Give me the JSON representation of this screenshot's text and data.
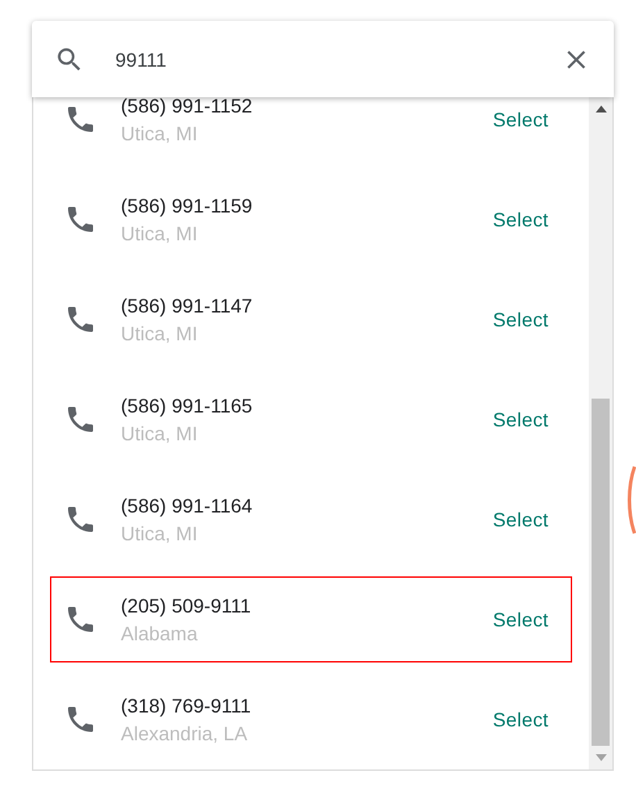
{
  "search": {
    "value": "99111"
  },
  "results": [
    {
      "number": "(586) 991-1152",
      "location": "Utica, MI",
      "action": "Select",
      "selected": false
    },
    {
      "number": "(586) 991-1159",
      "location": "Utica, MI",
      "action": "Select",
      "selected": false
    },
    {
      "number": "(586) 991-1147",
      "location": "Utica, MI",
      "action": "Select",
      "selected": false
    },
    {
      "number": "(586) 991-1165",
      "location": "Utica, MI",
      "action": "Select",
      "selected": false
    },
    {
      "number": "(586) 991-1164",
      "location": "Utica, MI",
      "action": "Select",
      "selected": false
    },
    {
      "number": "(205) 509-9111",
      "location": "Alabama",
      "action": "Select",
      "selected": true
    },
    {
      "number": "(318) 769-9111",
      "location": "Alexandria, LA",
      "action": "Select",
      "selected": false
    }
  ]
}
